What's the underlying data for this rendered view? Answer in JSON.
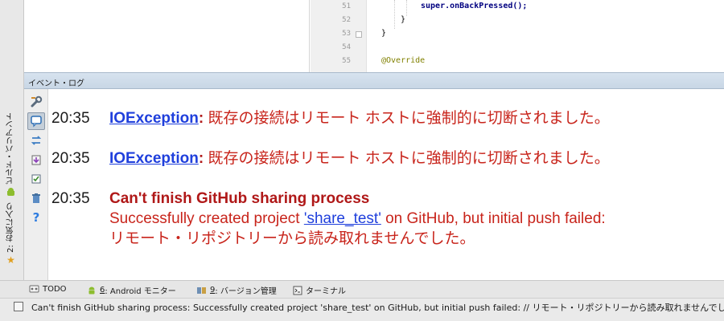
{
  "left_strip": {
    "build_variants_label": "ビルド・バリアント",
    "favorites_label": "2: お気に入り"
  },
  "editor": {
    "lines": [
      {
        "number": "51",
        "code": "super.onBackPressed();"
      },
      {
        "number": "52",
        "code": "}"
      },
      {
        "number": "53",
        "code": "}"
      },
      {
        "number": "54",
        "code": ""
      },
      {
        "number": "55",
        "code": "@Override"
      }
    ]
  },
  "event_log": {
    "title": "イベント・ログ",
    "entries": [
      {
        "time": "20:35",
        "link": "IOException",
        "sep": ":",
        "message": "既存の接続はリモート ホストに強制的に切断されました。"
      },
      {
        "time": "20:35",
        "link": "IOException",
        "sep": ":",
        "message": "既存の接続はリモート ホストに強制的に切断されました。"
      },
      {
        "time": "20:35",
        "title": "Can't finish GitHub sharing process",
        "line2_pre": "Successfully created project ",
        "line2_link": "'share_test'",
        "line2_post": " on GitHub, but initial push failed:",
        "line3": "リモート・リポジトリーから読み取れませんでした。"
      }
    ]
  },
  "bottom_tabs": {
    "todo": {
      "label": "TODO"
    },
    "android": {
      "num": "6",
      "label": ": Android モニター"
    },
    "vcs": {
      "num": "9",
      "label": ": バージョン管理"
    },
    "terminal": {
      "label": "ターミナル"
    }
  },
  "status_bar": {
    "text": "Can't finish GitHub sharing process: Successfully created project 'share_test' on GitHub, but initial push failed: // リモート・リポジトリーから読み取れませんでした"
  },
  "icons": {
    "toolbar": [
      "settings-wrench-icon",
      "comment-bubble-icon",
      "sync-arrows-icon",
      "export-icon",
      "checkbox-icon",
      "trash-icon",
      "help-icon"
    ],
    "tabs": [
      "todo-icon",
      "android-icon",
      "vcs-icon",
      "terminal-icon"
    ]
  },
  "colors": {
    "link": "#1f3fdc",
    "error_red": "#c8241b",
    "header_blue": "#c8d6e5"
  }
}
